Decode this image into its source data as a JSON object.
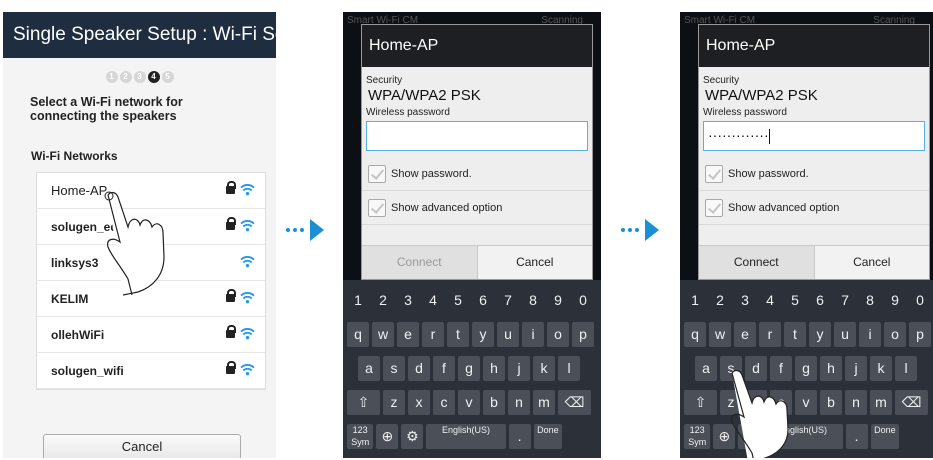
{
  "panel1": {
    "title": "Single Speaker Setup : Wi-Fi Setup",
    "steps": [
      "1",
      "2",
      "3",
      "4",
      "5"
    ],
    "active_step": 4,
    "instruction": "Select a Wi-Fi network for connecting the speakers",
    "networks_label": "Wi-Fi Networks",
    "networks": [
      {
        "name": "Home-AP",
        "secured": true
      },
      {
        "name": "solugen_edu",
        "secured": true
      },
      {
        "name": "linksys3",
        "secured": false
      },
      {
        "name": "KELIM",
        "secured": true
      },
      {
        "name": "ollehWiFi",
        "secured": true
      },
      {
        "name": "solugen_wifi",
        "secured": true
      }
    ],
    "cancel_label": "Cancel"
  },
  "background": {
    "app_title": "Smart Wi-Fi CM",
    "status": "Scanning"
  },
  "dialog": {
    "title": "Home-AP",
    "security_label": "Security",
    "security_value": "WPA/WPA2 PSK",
    "password_label": "Wireless password",
    "password_masked": "·············",
    "show_password": "Show password.",
    "show_advanced": "Show advanced option",
    "connect": "Connect",
    "cancel": "Cancel"
  },
  "keyboard": {
    "numbers": [
      "1",
      "2",
      "3",
      "4",
      "5",
      "6",
      "7",
      "8",
      "9",
      "0"
    ],
    "row1": [
      "q",
      "w",
      "e",
      "r",
      "t",
      "y",
      "u",
      "i",
      "o",
      "p"
    ],
    "row2": [
      "a",
      "s",
      "d",
      "f",
      "g",
      "h",
      "j",
      "k",
      "l"
    ],
    "row3": [
      "z",
      "x",
      "c",
      "v",
      "b",
      "n",
      "m"
    ],
    "sym": "123 Sym",
    "language": "English(US)",
    "done": "Done",
    "period": "."
  },
  "colors": {
    "title_bar": "#1f2d40",
    "wifi_blue": "#2196f3",
    "arrow_blue": "#1a8fd6",
    "field_border": "#56b1e6"
  }
}
